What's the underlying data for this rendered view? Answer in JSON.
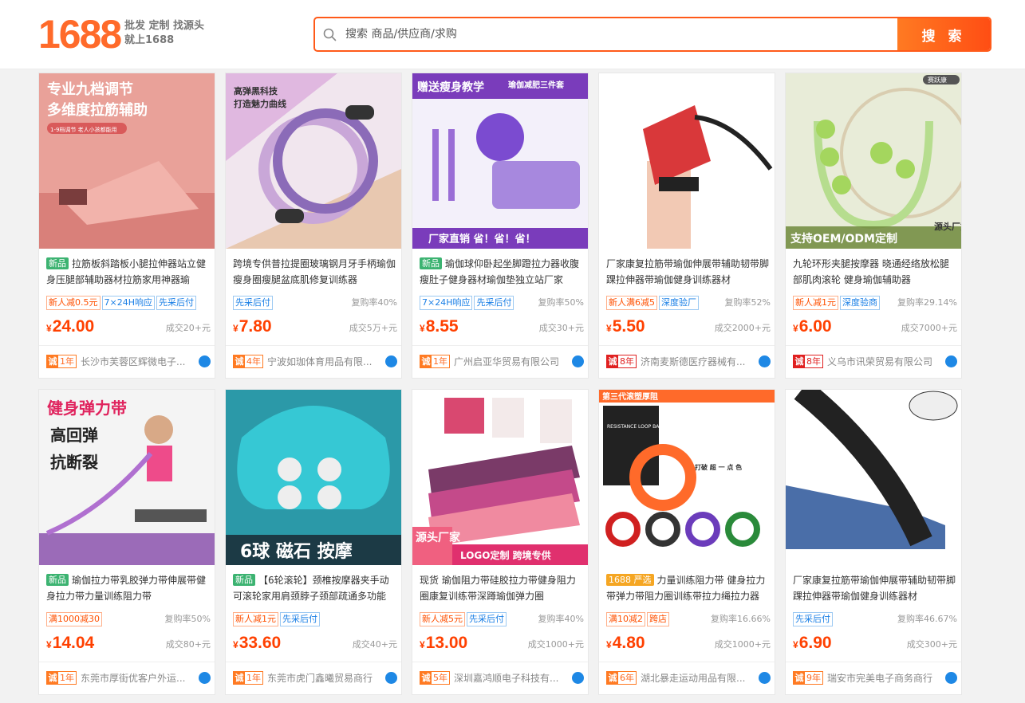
{
  "header": {
    "logo": "1688",
    "slogan_line1": "批发 定制 找源头",
    "slogan_line2": "就上1688",
    "search_placeholder": "搜索 商品/供应商/求购",
    "search_button": "搜 索"
  },
  "colors": {
    "brand": "#ff6a2a",
    "price": "#ff4000",
    "tag_blue": "#1a7fe6",
    "new_badge": "#3cb371"
  },
  "products": [
    {
      "image": {
        "icon": "stretch-board-image",
        "bg": "#e9a199",
        "caption1": "专业九档调节",
        "caption2": "多维度拉筋辅助",
        "caption3": "1-9档调节 老人小孩都能用"
      },
      "badge": "新品",
      "badge_color": "#3cb371",
      "title": "拉筋板斜踏板小腿拉伸器站立健身压腿部辅助器材拉筋家用神器瑜",
      "tags": [
        {
          "text": "新人减0.5元",
          "color": "red"
        },
        {
          "text": "7×24H响应",
          "color": "blue"
        },
        {
          "text": "先采后付",
          "color": "blue"
        }
      ],
      "repurchase": "",
      "price": "24.00",
      "sold": "成交20+元",
      "years": "1年",
      "year_color": "orange",
      "seller": "长沙市芙蓉区辉微电子..."
    },
    {
      "image": {
        "icon": "pilates-ring-image",
        "bg": "#f0d2e2",
        "caption1": "高弹黑科技",
        "caption2": "打造魅力曲线",
        "caption3": ""
      },
      "badge": "",
      "badge_color": "",
      "title": "跨境专供普拉提圈玻璃钢月牙手柄瑜伽瘦身圈瘦腿盆底肌修复训练器",
      "tags": [
        {
          "text": "先采后付",
          "color": "blue"
        }
      ],
      "repurchase": "复购率40%",
      "price": "7.80",
      "sold": "成交5万+元",
      "years": "4年",
      "year_color": "orange",
      "seller": "宁波如珈体育用品有限..."
    },
    {
      "image": {
        "icon": "yoga-set-image",
        "bg": "#f3f0fa",
        "caption1": "赠送瘦身教学",
        "caption2": "瑜伽减肥三件套",
        "caption3": "厂家直销 省！省！省！"
      },
      "badge": "新品",
      "badge_color": "#3cb371",
      "title": "瑜伽球仰卧起坐脚蹬拉力器收腹瘦肚子健身器材瑜伽垫独立站厂家",
      "tags": [
        {
          "text": "7×24H响应",
          "color": "blue"
        },
        {
          "text": "先采后付",
          "color": "blue"
        }
      ],
      "repurchase": "复购率50%",
      "price": "8.55",
      "sold": "成交30+元",
      "years": "1年",
      "year_color": "orange",
      "seller": "广州启亚华贸易有限公司"
    },
    {
      "image": {
        "icon": "ankle-strap-image",
        "bg": "#ffffff",
        "caption1": "",
        "caption2": "",
        "caption3": ""
      },
      "badge": "",
      "badge_color": "",
      "title": "厂家康复拉筋带瑜伽伸展带辅助韧带脚踝拉伸器带瑜伽健身训练器材",
      "tags": [
        {
          "text": "新人满6减5",
          "color": "red"
        },
        {
          "text": "深度验厂",
          "color": "blue"
        }
      ],
      "repurchase": "复购率52%",
      "price": "5.50",
      "sold": "成交2000+元",
      "years": "8年",
      "year_color": "red",
      "seller": "济南麦斯德医疗器械有..."
    },
    {
      "image": {
        "icon": "massage-roller-image",
        "bg": "#e8ecd8",
        "caption1": "支持OEM/ODM定制",
        "caption2": "源头厂货",
        "caption3": "赛跃康"
      },
      "badge": "",
      "badge_color": "",
      "title": "九轮环形夹腿按摩器 晓通经络放松腿部肌肉滚轮 健身瑜伽辅助器",
      "tags": [
        {
          "text": "新人减1元",
          "color": "red"
        },
        {
          "text": "深度验商",
          "color": "blue"
        }
      ],
      "repurchase": "复购率29.14%",
      "price": "6.00",
      "sold": "成交7000+元",
      "years": "8年",
      "year_color": "red",
      "seller": "义乌市讯荣贸易有限公司"
    },
    {
      "image": {
        "icon": "resistance-band-image",
        "bg": "#f4f4f4",
        "caption1": "健身弹力带",
        "caption2": "高回弹",
        "caption3": "抗断裂"
      },
      "badge": "新品",
      "badge_color": "#3cb371",
      "title": "瑜伽拉力带乳胶弹力带伸展带健身拉力带力量训练阻力带",
      "tags": [
        {
          "text": "满1000减30",
          "color": "red"
        }
      ],
      "repurchase": "复购率50%",
      "price": "14.04",
      "sold": "成交80+元",
      "years": "1年",
      "year_color": "orange",
      "seller": "东莞市厚街优客户外运..."
    },
    {
      "image": {
        "icon": "neck-massager-image",
        "bg": "#1c3a45",
        "caption1": "6球 磁石 按摩",
        "caption2": "",
        "caption3": ""
      },
      "badge": "新品",
      "badge_color": "#3cb371",
      "title": "【6轮滚轮】颈椎按摩器夹手动可滚轮家用肩颈脖子颈部疏通多功能",
      "tags": [
        {
          "text": "新人减1元",
          "color": "red"
        },
        {
          "text": "先采后付",
          "color": "blue"
        }
      ],
      "repurchase": "",
      "price": "33.60",
      "sold": "成交40+元",
      "years": "1年",
      "year_color": "orange",
      "seller": "东莞市虎门鑫曦贸易商行"
    },
    {
      "image": {
        "icon": "loop-bands-image",
        "bg": "#ffffff",
        "caption1": "源头厂家",
        "caption2": "LOGO定制 跨境专供",
        "caption3": ""
      },
      "badge": "",
      "badge_color": "",
      "title": "现货 瑜伽阻力带硅胶拉力带健身阻力圈康复训练带深蹲瑜伽弹力圈",
      "tags": [
        {
          "text": "新人减5元",
          "color": "red"
        },
        {
          "text": "先采后付",
          "color": "blue"
        }
      ],
      "repurchase": "复购率40%",
      "price": "13.00",
      "sold": "成交1000+元",
      "years": "5年",
      "year_color": "orange",
      "seller": "深圳嘉鸿顺电子科技有..."
    },
    {
      "image": {
        "icon": "power-band-image",
        "bg": "#ffffff",
        "caption1": "第三代滚塑厚阻",
        "caption2": "RESISTANCE LOOP BAND",
        "caption3": "打破 超 一 点 色"
      },
      "badge": "1688 严选",
      "badge_color": "#f5a623",
      "title": "力量训练阻力带 健身拉力带弹力带阻力圈训练带拉力绳拉力器",
      "tags": [
        {
          "text": "满10减2",
          "color": "red"
        },
        {
          "text": "跨店",
          "color": "red"
        }
      ],
      "repurchase": "复购率16.66%",
      "price": "4.80",
      "sold": "成交1000+元",
      "years": "6年",
      "year_color": "orange",
      "seller": "湖北暴走运动用品有限..."
    },
    {
      "image": {
        "icon": "foot-strap-image",
        "bg": "#ffffff",
        "caption1": "",
        "caption2": "",
        "caption3": ""
      },
      "badge": "",
      "badge_color": "",
      "title": "厂家康复拉筋带瑜伽伸展带辅助韧带脚踝拉伸器带瑜伽健身训练器材",
      "tags": [
        {
          "text": "先采后付",
          "color": "blue"
        }
      ],
      "repurchase": "复购率46.67%",
      "price": "6.90",
      "sold": "成交300+元",
      "years": "9年",
      "year_color": "orange",
      "seller": "瑞安市完美电子商务商行"
    }
  ]
}
